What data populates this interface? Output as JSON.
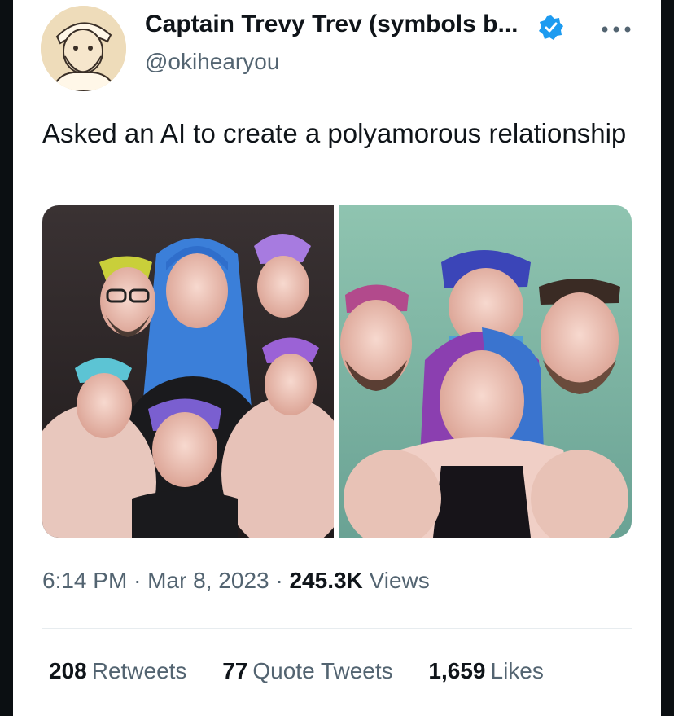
{
  "author": {
    "display_name": "Captain Trevy Trev (symbols b...",
    "handle": "@okihearyou",
    "verified_icon": "verified-badge-icon",
    "colors": {
      "verified": "#1d9bf0"
    }
  },
  "menu": {
    "icon": "more-options-icon"
  },
  "tweet": {
    "text": "Asked an AI to create a polyamorous relationship"
  },
  "media": {
    "image_icons": [
      "group-portrait-image-left",
      "group-portrait-image-right"
    ]
  },
  "meta": {
    "time": "6:14 PM",
    "sep1": "·",
    "date": "Mar 8, 2023",
    "sep2": "·",
    "views_count": "245.3K",
    "views_label": "Views"
  },
  "stats": {
    "retweets_count": "208",
    "retweets_label": "Retweets",
    "quotes_count": "77",
    "quotes_label": "Quote Tweets",
    "likes_count": "1,659",
    "likes_label": "Likes"
  }
}
